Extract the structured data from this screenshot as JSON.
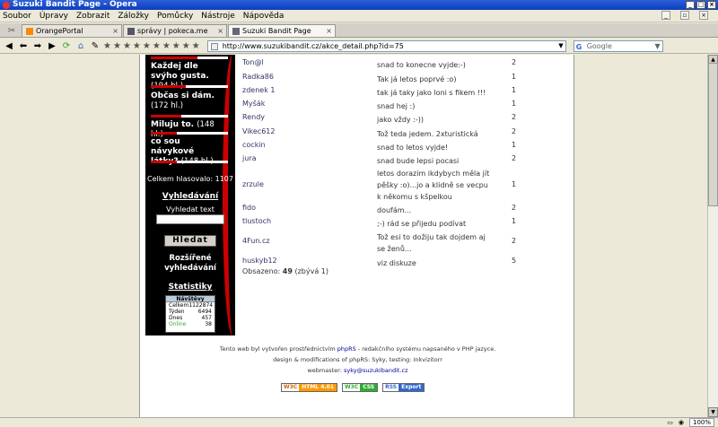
{
  "window": {
    "title": "Suzuki Bandit Page - Opera"
  },
  "menu": [
    "Soubor",
    "Úpravy",
    "Zobrazit",
    "Záložky",
    "Pomůcky",
    "Nástroje",
    "Nápověda"
  ],
  "tabs": [
    {
      "label": "OrangePortal",
      "active": false,
      "color": "#ff8800"
    },
    {
      "label": "správy | pokeca.me",
      "active": false,
      "color": "#556"
    },
    {
      "label": "Suzuki Bandit Page",
      "active": true,
      "color": "#667"
    }
  ],
  "address": {
    "url": "http://www.suzukibandit.cz/akce_detail.php?id=75"
  },
  "search": {
    "placeholder": "Google"
  },
  "sidebar": {
    "poll_items": [
      {
        "text": "Každej dle svýho gusta.",
        "votes": "(194 hl.)",
        "ratio": 0.45
      },
      {
        "text": "Občas si dám.",
        "votes": "(172 hl.)",
        "ratio": 0.4
      },
      {
        "text": "Miluju to.",
        "votes": "(148 hl.)",
        "ratio": 0.34
      },
      {
        "text": "co sou návykové látky?",
        "votes": "(148 hl.)",
        "ratio": 0.34
      }
    ],
    "total": "Celkem hlasovalo: 1107",
    "search_heading": "Vyhledávání",
    "search_label": "Vyhledat text",
    "search_button": "Hledat",
    "advanced_search": "Rozšířené vyhledávání",
    "stats_heading": "Statistiky",
    "stats": {
      "title": "Návštěvy",
      "rows": [
        {
          "label": "Celkem",
          "value": "1122874"
        },
        {
          "label": "Týden",
          "value": "6494"
        },
        {
          "label": "Dnes",
          "value": "457"
        },
        {
          "label": "Online",
          "value": "38"
        }
      ]
    }
  },
  "entries": [
    {
      "nick": "Ton@l",
      "message": "snad to konecne vyjde:-)",
      "count": "2"
    },
    {
      "nick": "Radka86",
      "message": "Tak já letos poprvé :o)",
      "count": "1"
    },
    {
      "nick": "zdenek 1",
      "message": "tak já taky jako loni s fikem !!!",
      "count": "1"
    },
    {
      "nick": "Myšák",
      "message": "snad hej :)",
      "count": "1"
    },
    {
      "nick": "Rendy",
      "message": "jako vždy :-))",
      "count": "2"
    },
    {
      "nick": "Vikec612",
      "message": "Tož teda jedem. 2xturistická",
      "count": "2"
    },
    {
      "nick": "cockin",
      "message": "snad to letos vyjde!",
      "count": "1"
    },
    {
      "nick": "jura",
      "message": "snad bude lepsi pocasi",
      "count": "2"
    },
    {
      "nick": "zrzule",
      "message": "letos dorazim ikdybych měla jít pěšky :o)...jo a klidně se vecpu k někomu s kšpelkou",
      "count": "1"
    },
    {
      "nick": "fido",
      "message": "doufám...",
      "count": "2"
    },
    {
      "nick": "tlustoch",
      "message": ";-) rád se přijedu podívat",
      "count": "1"
    },
    {
      "nick": "4Fun.cz",
      "message": "Tož esi to dožiju tak dojdem aj se ženů...",
      "count": "2"
    },
    {
      "nick": "huskyb12",
      "message": "viz diskuze",
      "count": "5"
    }
  ],
  "occupancy": {
    "label": "Obsazeno:",
    "value": "49",
    "remaining": "(zbývá 1)"
  },
  "footer": {
    "line1_pre": "Tento web byl vytvořen prostřednictvím",
    "line1_link": "phpRS",
    "line1_post": "- redakčního systému napsaného v PHP jazyce.",
    "line2": "design & modifications of phpRS: Syky, testing: Inkvizitorr",
    "line3_pre": "webmaster:",
    "line3_link": "syky@suzukibandit.cz",
    "badges": [
      {
        "left": "W3C",
        "right": "HTML 4.01",
        "color": "#f90"
      },
      {
        "left": "W3C",
        "right": "CSS",
        "color": "#3a3"
      },
      {
        "left": "RSS",
        "right": "Export",
        "color": "#36c"
      }
    ]
  },
  "status": {
    "zoom": "100%"
  }
}
